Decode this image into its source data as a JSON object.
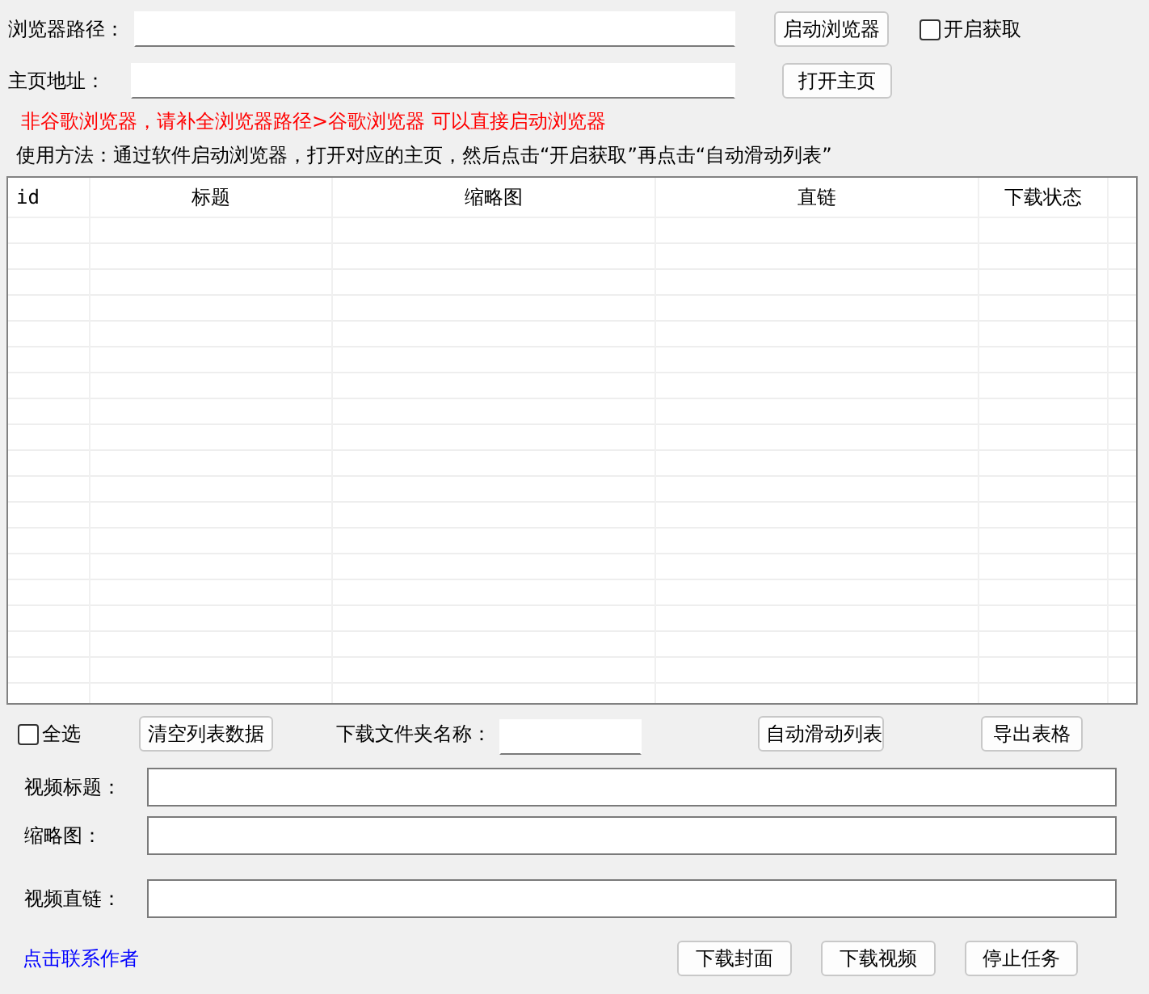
{
  "browser_path": {
    "label": "浏览器路径："
  },
  "launch_button": "启动浏览器",
  "fetch_toggle": {
    "label": "开启获取",
    "checked": false
  },
  "homepage": {
    "label": "主页地址："
  },
  "open_home_button": "打开主页",
  "warning": "非谷歌浏览器，请补全浏览器路径>谷歌浏览器 可以直接启动浏览器",
  "usage": "使用方法：通过软件启动浏览器，打开对应的主页，然后点击“开启获取”再点击“自动滑动列表”",
  "table": {
    "columns": [
      "id",
      "标题",
      "缩略图",
      "直链",
      "下载状态"
    ]
  },
  "select_all": {
    "label": "全选",
    "checked": false
  },
  "clear_button": "清空列表数据",
  "folder": {
    "label": "下载文件夹名称："
  },
  "auto_scroll_button": "自动滑动列表",
  "export_button": "导出表格",
  "fields": [
    {
      "label": "视频标题："
    },
    {
      "label": "缩略图："
    },
    {
      "label": "视频直链："
    }
  ],
  "contact_link": "点击联系作者",
  "actions": [
    "下载封面",
    "下载视频",
    "停止任务"
  ]
}
